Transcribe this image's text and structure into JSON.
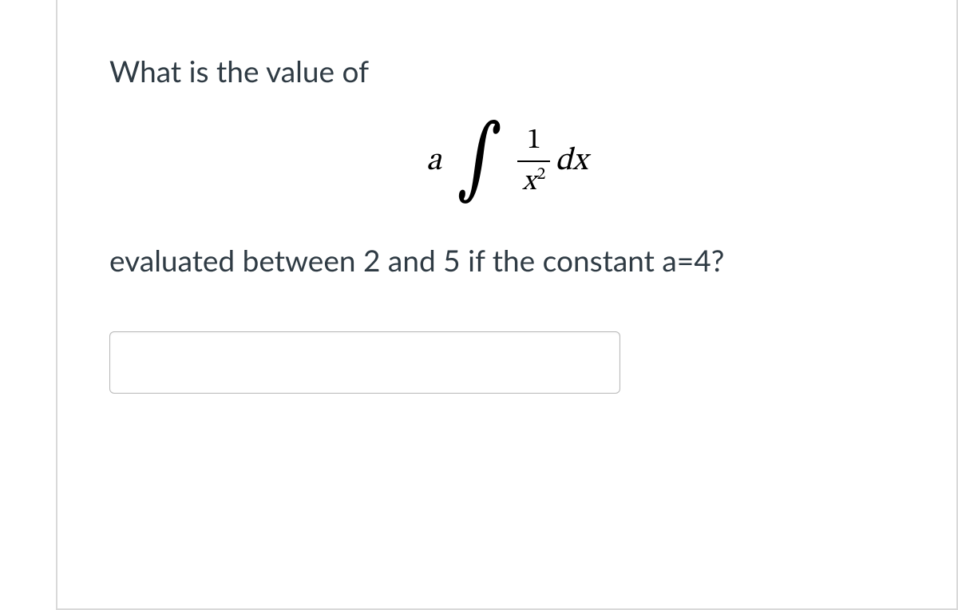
{
  "question": {
    "line1": "What is the value of",
    "line2": "evaluated between 2 and 5 if the constant a=4?"
  },
  "math": {
    "coefficient": "a",
    "integral_symbol": "∫",
    "numerator": "1",
    "denominator_var": "x",
    "denominator_power": "2",
    "differential": "dx"
  },
  "answer": {
    "value": ""
  }
}
